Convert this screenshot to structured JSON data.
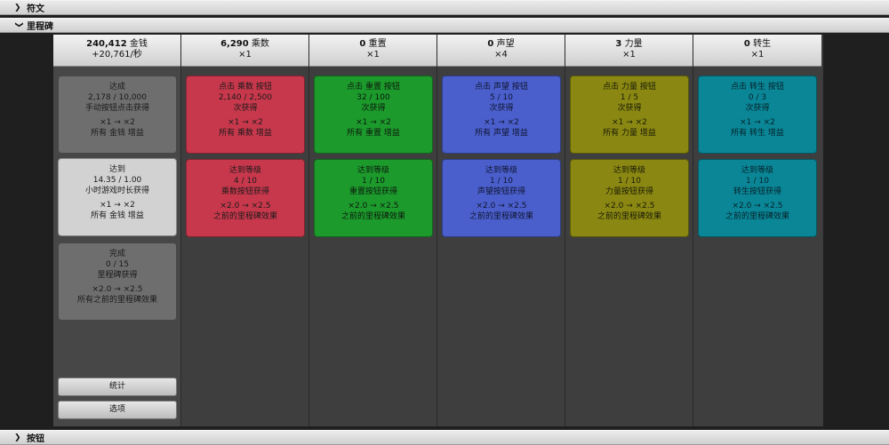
{
  "sections": {
    "top": "符文",
    "mid": "里程碑",
    "bottom": "按钮"
  },
  "columns": [
    {
      "header_num": "240,412",
      "header_name": "金钱",
      "header_sub": "+20,761/秒",
      "cards": [
        {
          "l1": "达成",
          "l2": "2,178 / 10,000",
          "l3": "手动按钮点击获得",
          "l4": "×1 → ×2",
          "l5": "所有 金钱 增益"
        },
        {
          "l1": "达到",
          "l2": "14.35 / 1.00",
          "l3": "小时游戏时长获得",
          "l4": "×1 → ×2",
          "l5": "所有 金钱 增益"
        },
        {
          "l1": "完成",
          "l2": "0 / 15",
          "l3": "里程碑获得",
          "l4": "×2.0 → ×2.5",
          "l5": "所有之前的里程碑效果"
        }
      ],
      "buttons": [
        "统计",
        "选项"
      ]
    },
    {
      "header_num": "6,290",
      "header_name": "乘数",
      "header_sub": "×1",
      "cards": [
        {
          "l1": "点击 乘数 按钮",
          "l2": "2,140 / 2,500",
          "l3": "次获得",
          "l4": "×1 → ×2",
          "l5": "所有 乘数 增益"
        },
        {
          "l1": "达到等级",
          "l2": "4 / 10",
          "l3": "乘数按钮获得",
          "l4": "×2.0 → ×2.5",
          "l5": "之前的里程碑效果"
        }
      ]
    },
    {
      "header_num": "0",
      "header_name": "重置",
      "header_sub": "×1",
      "cards": [
        {
          "l1": "点击 重置 按钮",
          "l2": "32 / 100",
          "l3": "次获得",
          "l4": "×1 → ×2",
          "l5": "所有 重置 增益"
        },
        {
          "l1": "达到等级",
          "l2": "1 / 10",
          "l3": "重置按钮获得",
          "l4": "×2.0 → ×2.5",
          "l5": "之前的里程碑效果"
        }
      ]
    },
    {
      "header_num": "0",
      "header_name": "声望",
      "header_sub": "×4",
      "cards": [
        {
          "l1": "点击 声望 按钮",
          "l2": "5 / 10",
          "l3": "次获得",
          "l4": "×1 → ×2",
          "l5": "所有 声望 增益"
        },
        {
          "l1": "达到等级",
          "l2": "1 / 10",
          "l3": "声望按钮获得",
          "l4": "×2.0 → ×2.5",
          "l5": "之前的里程碑效果"
        }
      ]
    },
    {
      "header_num": "3",
      "header_name": "力量",
      "header_sub": "×1",
      "cards": [
        {
          "l1": "点击 力量 按钮",
          "l2": "1 / 5",
          "l3": "次获得",
          "l4": "×1 → ×2",
          "l5": "所有 力量 增益"
        },
        {
          "l1": "达到等级",
          "l2": "1 / 10",
          "l3": "力量按钮获得",
          "l4": "×2.0 → ×2.5",
          "l5": "之前的里程碑效果"
        }
      ]
    },
    {
      "header_num": "0",
      "header_name": "转生",
      "header_sub": "×1",
      "cards": [
        {
          "l1": "点击 转生 按钮",
          "l2": "0 / 3",
          "l3": "次获得",
          "l4": "×1 → ×2",
          "l5": "所有 转生 增益"
        },
        {
          "l1": "达到等级",
          "l2": "1 / 10",
          "l3": "转生按钮获得",
          "l4": "×2.0 → ×2.5",
          "l5": "之前的里程碑效果"
        }
      ]
    }
  ],
  "colors": {
    "money": "#6e6e6e",
    "multiplier": "#c8384c",
    "reset": "#1c9a2c",
    "prestige": "#4a5fcc",
    "power": "#8a8812",
    "rebirth": "#0a8696"
  }
}
